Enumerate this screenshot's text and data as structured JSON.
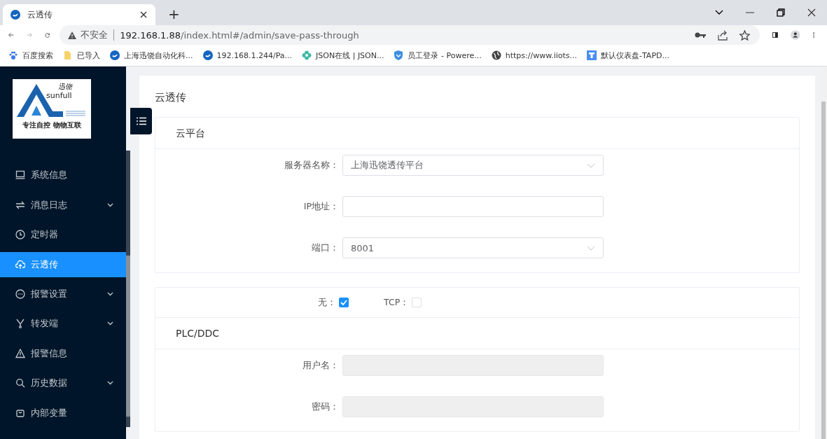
{
  "browser": {
    "tabs": [
      {
        "title": "云透传",
        "selected": true
      }
    ],
    "new_tab": "+",
    "address": {
      "warning": "不安全",
      "host": "192.168.1.88",
      "path": "/index.html#/admin/save-pass-through"
    },
    "bookmarks": [
      {
        "label": "百度搜索"
      },
      {
        "label": "已导入"
      },
      {
        "label": "上海迅饶自动化科..."
      },
      {
        "label": "192.168.1.244/Pa..."
      },
      {
        "label": "JSON在线 | JSON..."
      },
      {
        "label": "员工登录 - Powere..."
      },
      {
        "label": "https://www.iiots..."
      },
      {
        "label": "默认仪表盘-TAPD..."
      }
    ]
  },
  "logo": {
    "name_cn": "迅饶",
    "name_en": "sunfull",
    "slogan": "专注自控 物物互联"
  },
  "sidebar": {
    "items": [
      {
        "label": "系统信息",
        "expandable": false,
        "selected": false
      },
      {
        "label": "消息日志",
        "expandable": true,
        "selected": false
      },
      {
        "label": "定时器",
        "expandable": false,
        "selected": false
      },
      {
        "label": "云透传",
        "expandable": false,
        "selected": true
      },
      {
        "label": "报警设置",
        "expandable": true,
        "selected": false
      },
      {
        "label": "转发端",
        "expandable": true,
        "selected": false
      },
      {
        "label": "报警信息",
        "expandable": false,
        "selected": false
      },
      {
        "label": "历史数据",
        "expandable": true,
        "selected": false
      },
      {
        "label": "内部变量",
        "expandable": false,
        "selected": false
      }
    ]
  },
  "page": {
    "title": "云透传",
    "sections": [
      {
        "title": "云平台",
        "fields": [
          {
            "label": "服务器名称：",
            "kind": "select",
            "value": "上海迅饶透传平台"
          },
          {
            "label": "IP地址：",
            "kind": "input"
          },
          {
            "label": "端口：",
            "kind": "select",
            "value": "8001"
          }
        ]
      },
      {
        "checkboxes": [
          {
            "label": "无：",
            "checked": true
          },
          {
            "label": "TCP：",
            "checked": false
          }
        ],
        "title": "PLC/DDC",
        "fields": [
          {
            "label": "用户名：",
            "kind": "input",
            "disabled": true
          },
          {
            "label": "密码：",
            "kind": "input",
            "disabled": true
          }
        ]
      }
    ]
  }
}
